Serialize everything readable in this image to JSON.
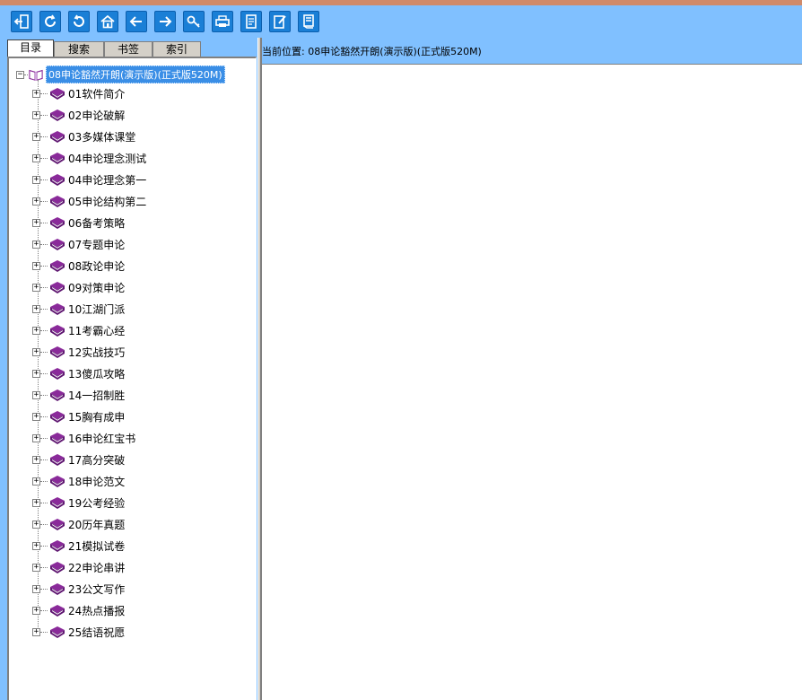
{
  "toolbar": {
    "buttons": [
      {
        "name": "exit",
        "icon": "exit-icon"
      },
      {
        "name": "refresh",
        "icon": "refresh-icon"
      },
      {
        "name": "undo",
        "icon": "undo-icon"
      },
      {
        "name": "home",
        "icon": "home-icon"
      },
      {
        "name": "back",
        "icon": "arrow-left-icon"
      },
      {
        "name": "forward",
        "icon": "arrow-right-icon"
      },
      {
        "name": "search",
        "icon": "key-icon"
      },
      {
        "name": "print",
        "icon": "printer-icon"
      },
      {
        "name": "notes",
        "icon": "note-icon"
      },
      {
        "name": "edit",
        "icon": "edit-icon"
      },
      {
        "name": "bookmark",
        "icon": "bookmark-icon"
      }
    ],
    "color": "#80c0ff",
    "button_color": "#1a7fd6"
  },
  "tabs": {
    "contents": "目录",
    "search": "搜索",
    "bookmarks": "书签",
    "index": "索引"
  },
  "tree": {
    "root_label": "08申论豁然开朗(演示版)(正式版520M)",
    "items": [
      "01软件简介",
      "02申论破解",
      "03多媒体课堂",
      "04申论理念测试",
      "04申论理念第一",
      "05申论结构第二",
      "06备考策略",
      "07专题申论",
      "08政论申论",
      "09对策申论",
      "10江湖门派",
      "11考霸心经",
      "12实战技巧",
      "13傻瓜攻略",
      "14一招制胜",
      "15胸有成申",
      "16申论红宝书",
      "17高分突破",
      "18申论范文",
      "19公考经验",
      "20历年真题",
      "21模拟试卷",
      "22申论串讲",
      "23公文写作",
      "24热点播报",
      "25结语祝愿"
    ],
    "selected_color": "#3a8ee6",
    "book_color": "#8a2a9a"
  },
  "location": {
    "text": "当前位置: 08申论豁然开朗(演示版)(正式版520M)"
  }
}
